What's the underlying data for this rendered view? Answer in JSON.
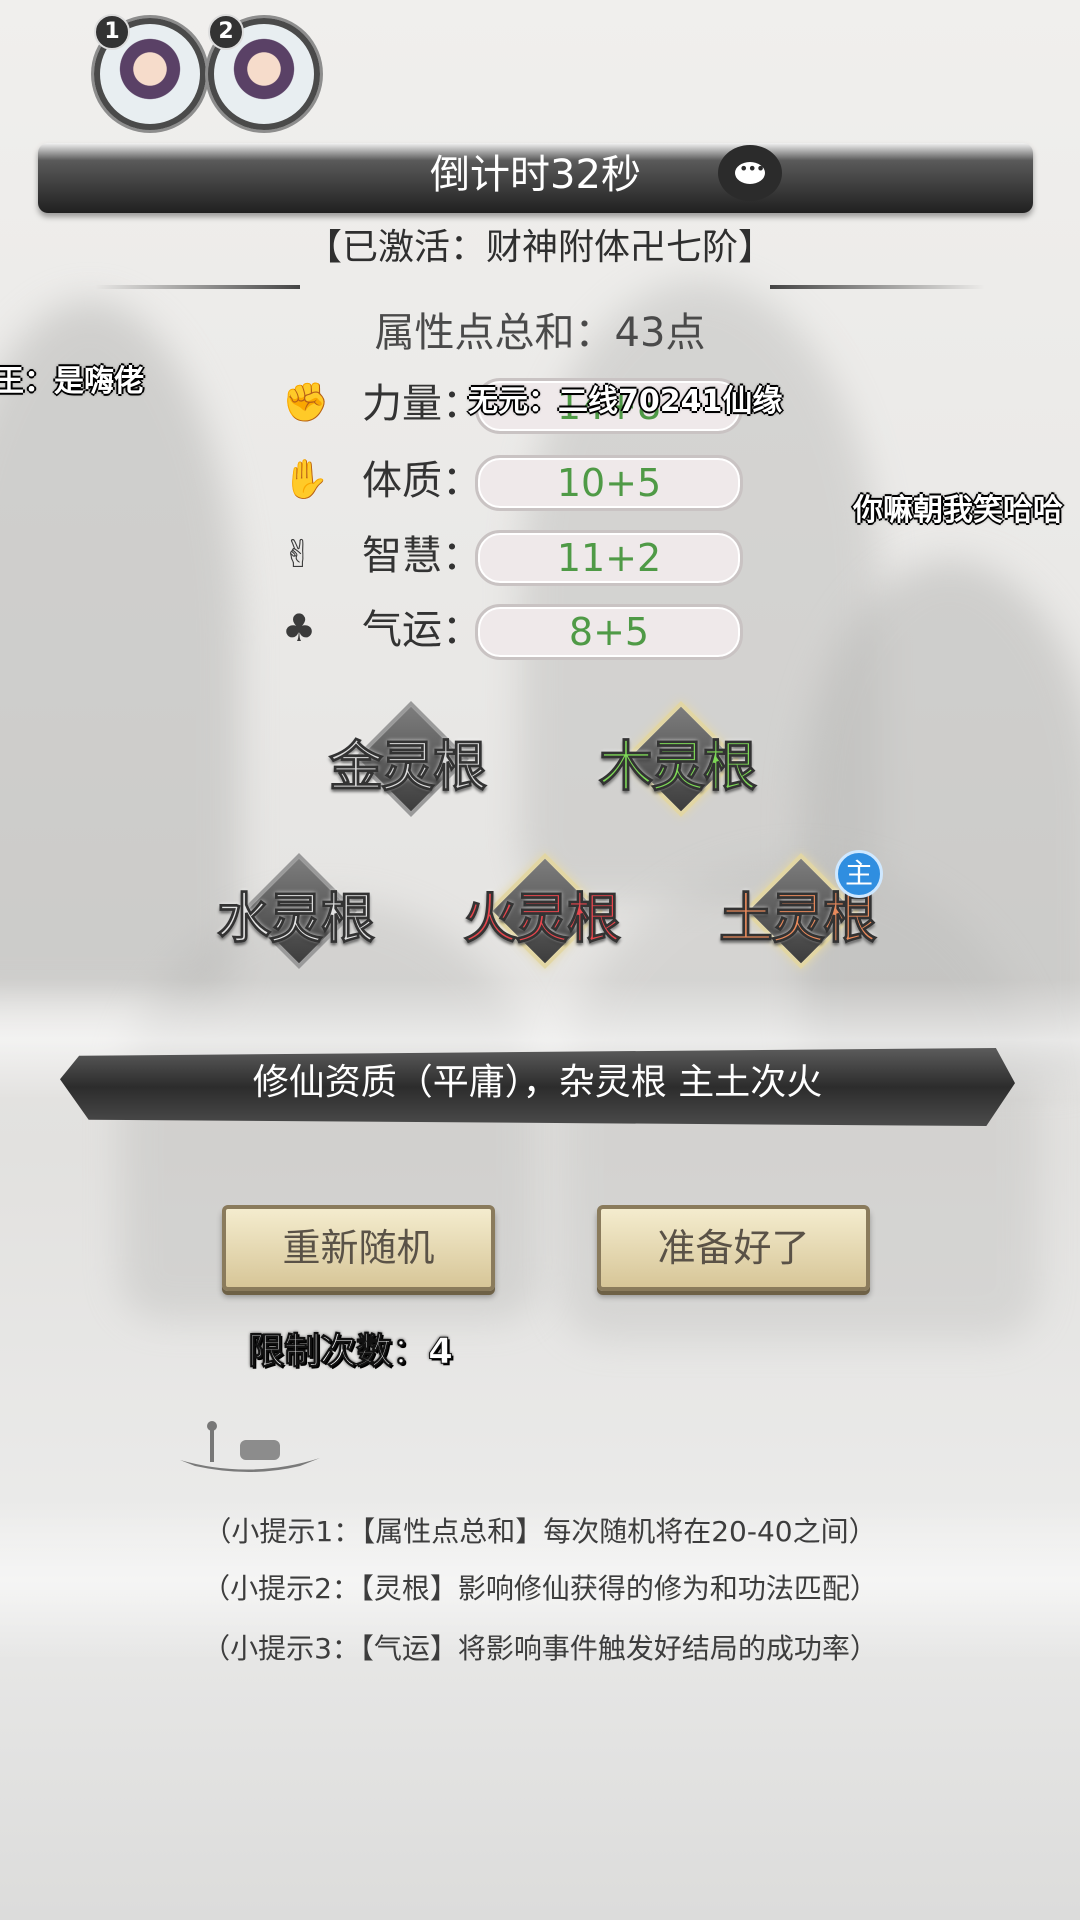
{
  "players": [
    {
      "badge": "1"
    },
    {
      "badge": "2"
    }
  ],
  "countdown": "倒计时32秒",
  "activated_buff": "【已激活：财神附体卍七阶】",
  "attribute_sum": "属性点总和：43点",
  "attributes": [
    {
      "icon": "fist-icon",
      "label": "力量：",
      "value": "14+8"
    },
    {
      "icon": "hand-icon",
      "label": "体质：",
      "value": "10+5"
    },
    {
      "icon": "victory-hand-icon",
      "label": "智慧：",
      "value": "11+2"
    },
    {
      "icon": "clover-icon",
      "label": "气运：",
      "value": "8+5"
    }
  ],
  "spirit_roots": [
    {
      "label": "金灵根",
      "color": "#dcdcdc",
      "active": false
    },
    {
      "label": "木灵根",
      "color": "#7ed957",
      "active": true
    },
    {
      "label": "水灵根",
      "color": "#e3e3e3",
      "active": false
    },
    {
      "label": "火灵根",
      "color": "#e8464d",
      "active": true
    },
    {
      "label": "土灵根",
      "color": "#e98a5c",
      "active": true
    }
  ],
  "main_root_badge": "主",
  "summary": "修仙资质（平庸），杂灵根 主土次火",
  "buttons": {
    "reroll": "重新随机",
    "ready": "准备好了"
  },
  "limit": "限制次数：4",
  "tips": [
    "（小提示1：【属性点总和】每次随机将在20-40之间）",
    "（小提示2：【灵根】影响修仙获得的修为和功法匹配）",
    "（小提示3：【气运】将影响事件触发好结局的成功率）"
  ],
  "danmaku": [
    "王：是嗨佬",
    "无元：二线70241仙缘",
    "你嘛朝我笑哈哈"
  ]
}
